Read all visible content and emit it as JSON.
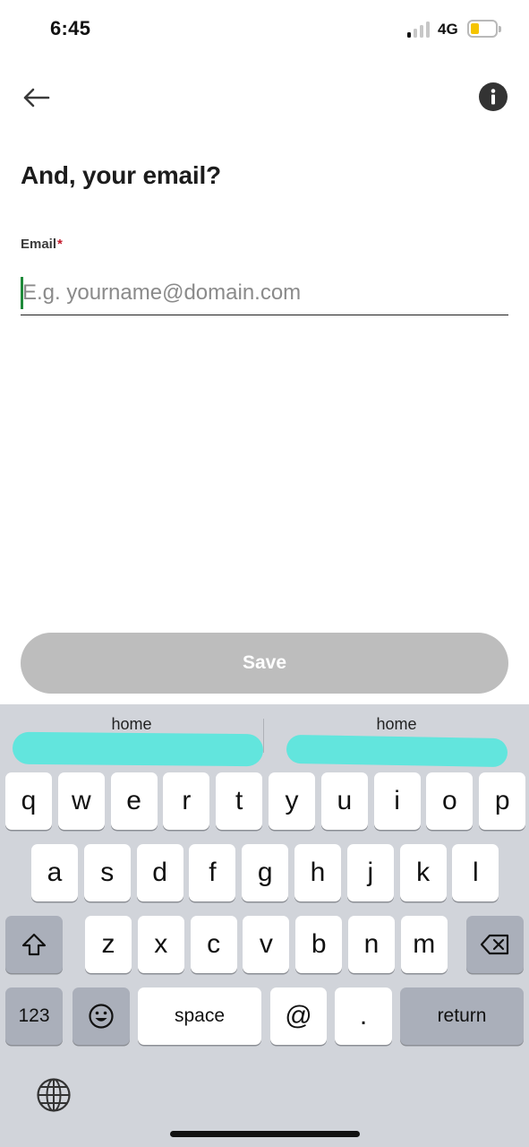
{
  "status_bar": {
    "time": "6:45",
    "network": "4G",
    "signal_bars_active": 1,
    "signal_bars_total": 4,
    "battery_level": 0.35,
    "battery_color": "#f5c400"
  },
  "header": {
    "back_icon": "arrow-left-icon",
    "info_icon": "info-icon"
  },
  "form": {
    "title": "And, your email?",
    "email_label": "Email",
    "required_mark": "*",
    "email_value": "",
    "email_placeholder": "E.g. yourname@domain.com",
    "caret_color": "#1f8a3a"
  },
  "save_button": {
    "label": "Save",
    "background": "#bdbdbd"
  },
  "keyboard": {
    "suggestions": [
      "home",
      "home"
    ],
    "row1": [
      "q",
      "w",
      "e",
      "r",
      "t",
      "y",
      "u",
      "i",
      "o",
      "p"
    ],
    "row2": [
      "a",
      "s",
      "d",
      "f",
      "g",
      "h",
      "j",
      "k",
      "l"
    ],
    "row3": [
      "z",
      "x",
      "c",
      "v",
      "b",
      "n",
      "m"
    ],
    "numbers_key": "123",
    "space_key": "space",
    "at_key": "@",
    "period_key": ".",
    "return_key": "return",
    "shift_icon": "shift-icon",
    "delete_icon": "backspace-icon",
    "emoji_icon": "emoji-icon",
    "globe_icon": "globe-icon"
  }
}
